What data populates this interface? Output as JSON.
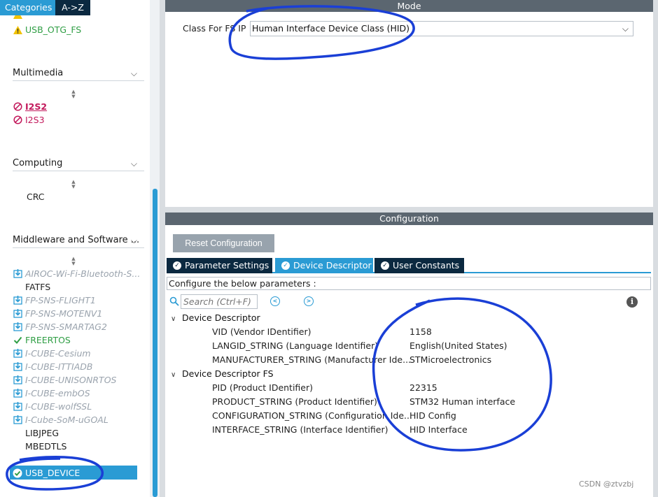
{
  "left": {
    "tabs": [
      "Categories",
      "A->Z"
    ],
    "top_items": [
      {
        "label": "USB_OTG_FS",
        "state": "warning"
      }
    ],
    "categories": [
      {
        "title": "Multimedia",
        "items": [
          {
            "label": "I2S2",
            "state": "disabled-bold"
          },
          {
            "label": "I2S3",
            "state": "disabled"
          }
        ]
      },
      {
        "title": "Computing",
        "items": [
          {
            "label": "CRC",
            "state": "plain"
          }
        ]
      },
      {
        "title": "Middleware and Software ...",
        "items": [
          {
            "label": "AIROC-Wi-Fi-Bluetooth-S...",
            "state": "pack"
          },
          {
            "label": "FATFS",
            "state": "plain"
          },
          {
            "label": "FP-SNS-FLIGHT1",
            "state": "pack"
          },
          {
            "label": "FP-SNS-MOTENV1",
            "state": "pack"
          },
          {
            "label": "FP-SNS-SMARTAG2",
            "state": "pack"
          },
          {
            "label": "FREERTOS",
            "state": "enabled"
          },
          {
            "label": "I-CUBE-Cesium",
            "state": "pack"
          },
          {
            "label": "I-CUBE-ITTIADB",
            "state": "pack"
          },
          {
            "label": "I-CUBE-UNISONRTOS",
            "state": "pack"
          },
          {
            "label": "I-CUBE-embOS",
            "state": "pack"
          },
          {
            "label": "I-CUBE-wolfSSL",
            "state": "pack"
          },
          {
            "label": "I-Cube-SoM-uGOAL",
            "state": "pack"
          },
          {
            "label": "LIBJPEG",
            "state": "plain"
          },
          {
            "label": "MBEDTLS",
            "state": "plain"
          },
          {
            "label": "USB_DEVICE",
            "state": "selected"
          }
        ]
      }
    ]
  },
  "mode": {
    "title": "Mode",
    "class_label": "Class For FS IP",
    "class_value": "Human Interface Device Class (HID)"
  },
  "config": {
    "title": "Configuration",
    "reset_label": "Reset Configuration",
    "tabs": [
      "Parameter Settings",
      "Device Descriptor",
      "User Constants"
    ],
    "active_tab": "Device Descriptor",
    "message": "Configure the below parameters :",
    "search_placeholder": "Search (Ctrl+F)",
    "groups": [
      {
        "name": "Device Descriptor",
        "params": [
          {
            "name": "VID (Vendor IDentifier)",
            "value": "1158"
          },
          {
            "name": "LANGID_STRING (Language Identifier)",
            "value": "English(United States)"
          },
          {
            "name": "MANUFACTURER_STRING (Manufacturer Ide...",
            "value": "STMicroelectronics"
          }
        ]
      },
      {
        "name": "Device Descriptor FS",
        "params": [
          {
            "name": "PID (Product IDentifier)",
            "value": "22315"
          },
          {
            "name": "PRODUCT_STRING (Product Identifier)",
            "value": "STM32 Human interface"
          },
          {
            "name": "CONFIGURATION_STRING (Configuration Ide...",
            "value": "HID Config"
          },
          {
            "name": "INTERFACE_STRING (Interface Identifier)",
            "value": "HID Interface"
          }
        ]
      }
    ]
  },
  "watermark": "CSDN @ztvzbj",
  "colors": {
    "accent": "#2a9bd4",
    "dark_tab": "#0b2940",
    "panel_header": "#5b6670",
    "annotation": "#1a3fd6"
  }
}
